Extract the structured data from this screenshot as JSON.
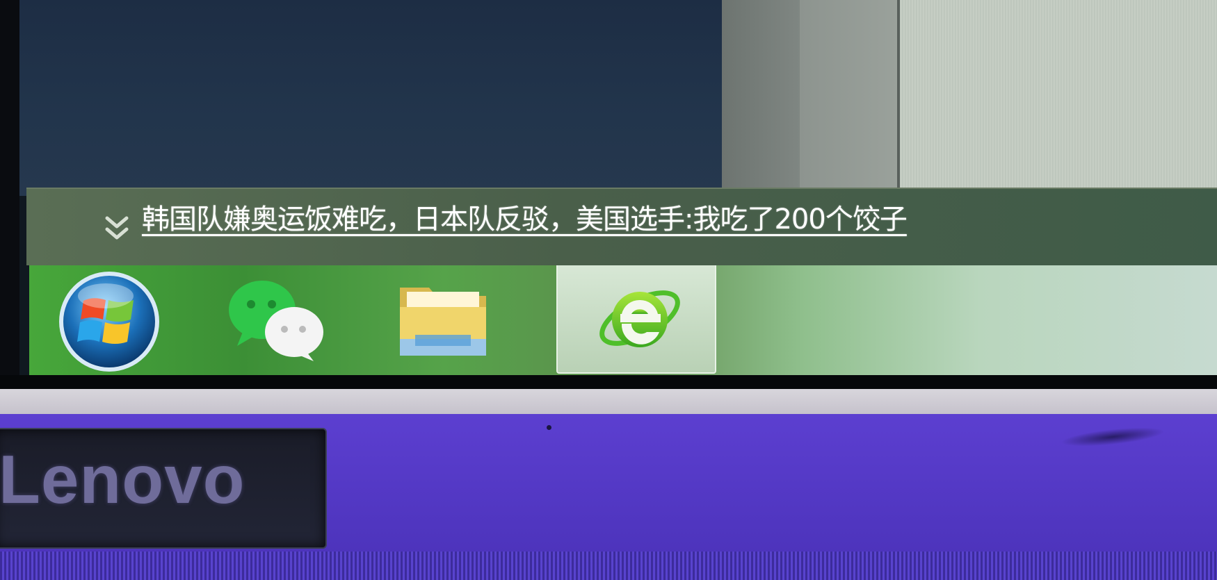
{
  "news_bar": {
    "expand_icon": "double-chevron-down-icon",
    "headline": "韩国队嫌奥运饭难吃，日本队反驳，美国选手:我吃了200个饺子"
  },
  "taskbar": {
    "items": [
      {
        "name": "start-button",
        "icon": "windows-logo-icon"
      },
      {
        "name": "wechat",
        "icon": "wechat-icon"
      },
      {
        "name": "file-explorer",
        "icon": "folder-icon"
      },
      {
        "name": "browser",
        "icon": "ie-browser-icon",
        "active": true
      }
    ]
  },
  "hardware": {
    "brand": "Lenovo"
  },
  "colors": {
    "taskbar_green": "#47a73a",
    "news_bar": "#4a5f4a",
    "chassis_purple": "#5338c4"
  }
}
